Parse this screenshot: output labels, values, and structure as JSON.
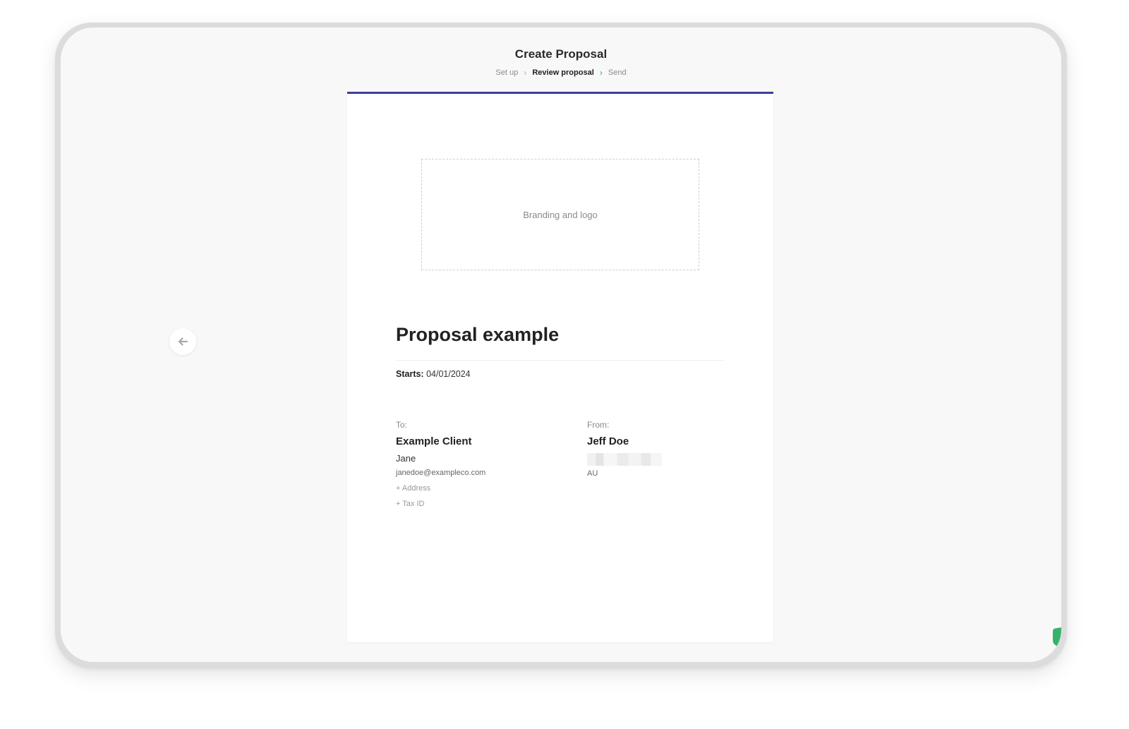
{
  "header": {
    "title": "Create Proposal",
    "steps": [
      "Set up",
      "Review proposal",
      "Send"
    ]
  },
  "proposal": {
    "branding_placeholder": "Branding and logo",
    "title": "Proposal example",
    "starts_label": "Starts:",
    "starts_value": "04/01/2024",
    "to": {
      "label": "To:",
      "company": "Example Client",
      "contact": "Jane",
      "email": "janedoe@exampleco.com",
      "add_address": "+ Address",
      "add_tax_id": "+ Tax ID"
    },
    "from": {
      "label": "From:",
      "name": "Jeff Doe",
      "country": "AU"
    }
  },
  "colors": {
    "accent": "#3b3fa0",
    "success": "#2fa866"
  },
  "icons": {
    "back": "arrow-left-icon",
    "step_separator": "chevron-right-icon"
  }
}
